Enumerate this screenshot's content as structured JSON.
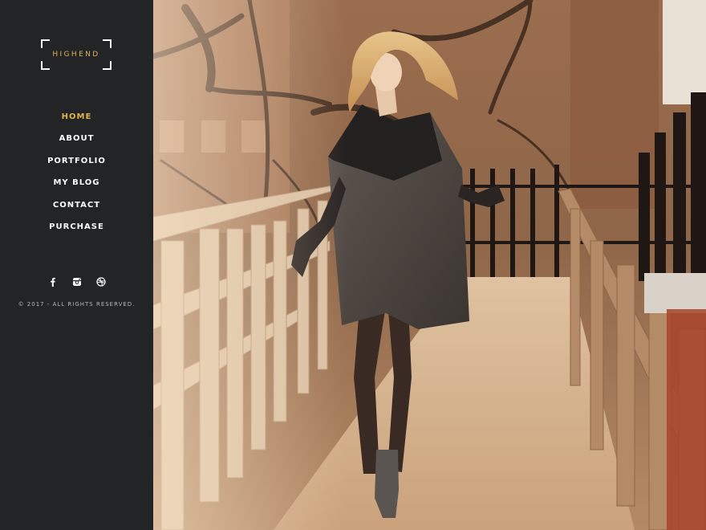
{
  "brand": {
    "name": "HIGHEND",
    "accent_color": "#e0b548"
  },
  "nav": {
    "items": [
      {
        "label": "HOME",
        "active": true
      },
      {
        "label": "ABOUT"
      },
      {
        "label": "PORTFOLIO"
      },
      {
        "label": "MY BLOG"
      },
      {
        "label": "CONTACT"
      },
      {
        "label": "PURCHASE"
      }
    ]
  },
  "social": {
    "icons": [
      "facebook-icon",
      "instagram-icon",
      "dribbble-icon"
    ]
  },
  "footer": {
    "copyright": "© 2017 - ALL RIGHTS RESERVED."
  },
  "hero": {
    "subject": "woman in grey wrap coat walking on wooden footbridge"
  }
}
